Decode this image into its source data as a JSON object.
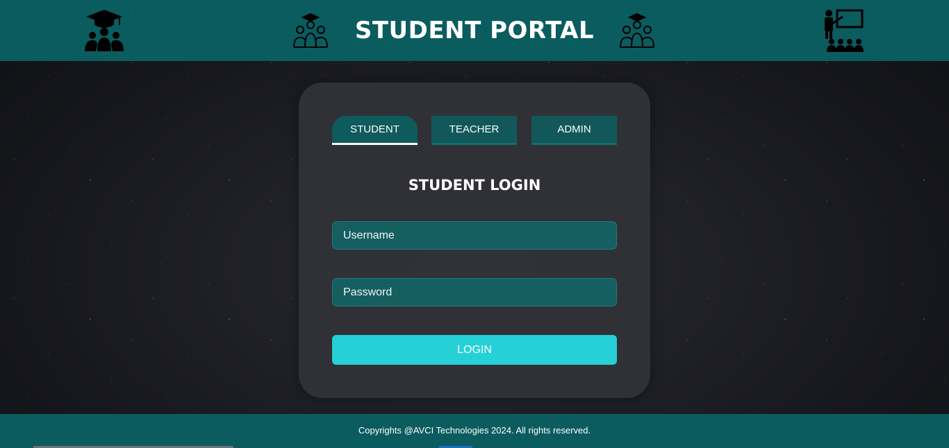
{
  "header": {
    "title": "STUDENT PORTAL",
    "icons": [
      "graduation-group-icon",
      "student-group-outline-icon",
      "student-group-outline-icon",
      "teacher-classroom-icon"
    ]
  },
  "tabs": [
    {
      "label": "STUDENT",
      "active": true
    },
    {
      "label": "TEACHER",
      "active": false
    },
    {
      "label": "ADMIN",
      "active": false
    }
  ],
  "login": {
    "title": "STUDENT LOGIN",
    "username_placeholder": "Username",
    "username_value": "",
    "password_placeholder": "Password",
    "password_value": "",
    "button_label": "LOGIN"
  },
  "footer": {
    "text": "Copyrights @AVCI Technologies 2024. All rights reserved."
  },
  "colors": {
    "header_bg": "#0b5c5f",
    "tab_bg": "#12585a",
    "field_bg": "#155f61",
    "button_bg": "#25d0d6",
    "card_bg": "#323338"
  }
}
